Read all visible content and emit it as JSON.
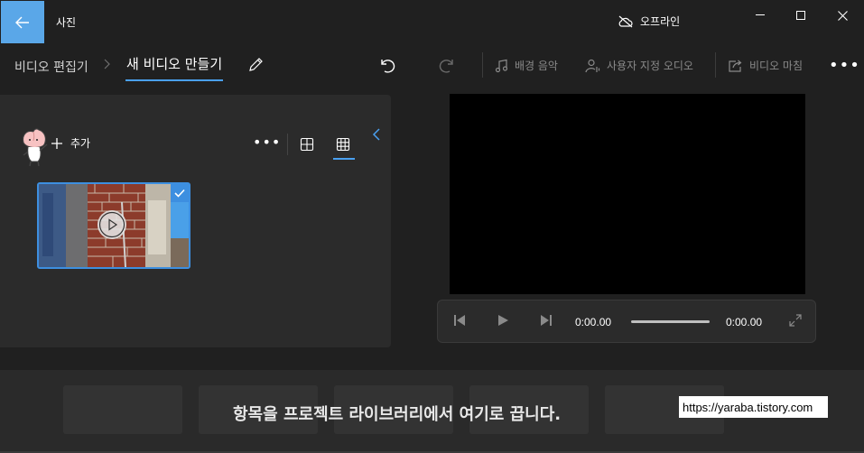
{
  "titlebar": {
    "app_title": "사진",
    "offline_label": "오프라인"
  },
  "toolbar": {
    "breadcrumb_parent": "비디오 편집기",
    "breadcrumb_current": "새 비디오 만들기",
    "background_music": "배경 음악",
    "custom_audio": "사용자 지정 오디오",
    "finish_video": "비디오 마침"
  },
  "library": {
    "add_label": "추가"
  },
  "player": {
    "current_time": "0:00.00",
    "total_time": "0:00.00",
    "progress": 0
  },
  "storyboard": {
    "empty_message": "항목을 프로젝트 라이브러리에서 여기로 끕니다."
  },
  "watermark": "https://yaraba.tistory.com",
  "colors": {
    "accent": "#3d8fe0",
    "back_button": "#5aa7e8",
    "background": "#202020",
    "panel": "#2b2b2b"
  }
}
